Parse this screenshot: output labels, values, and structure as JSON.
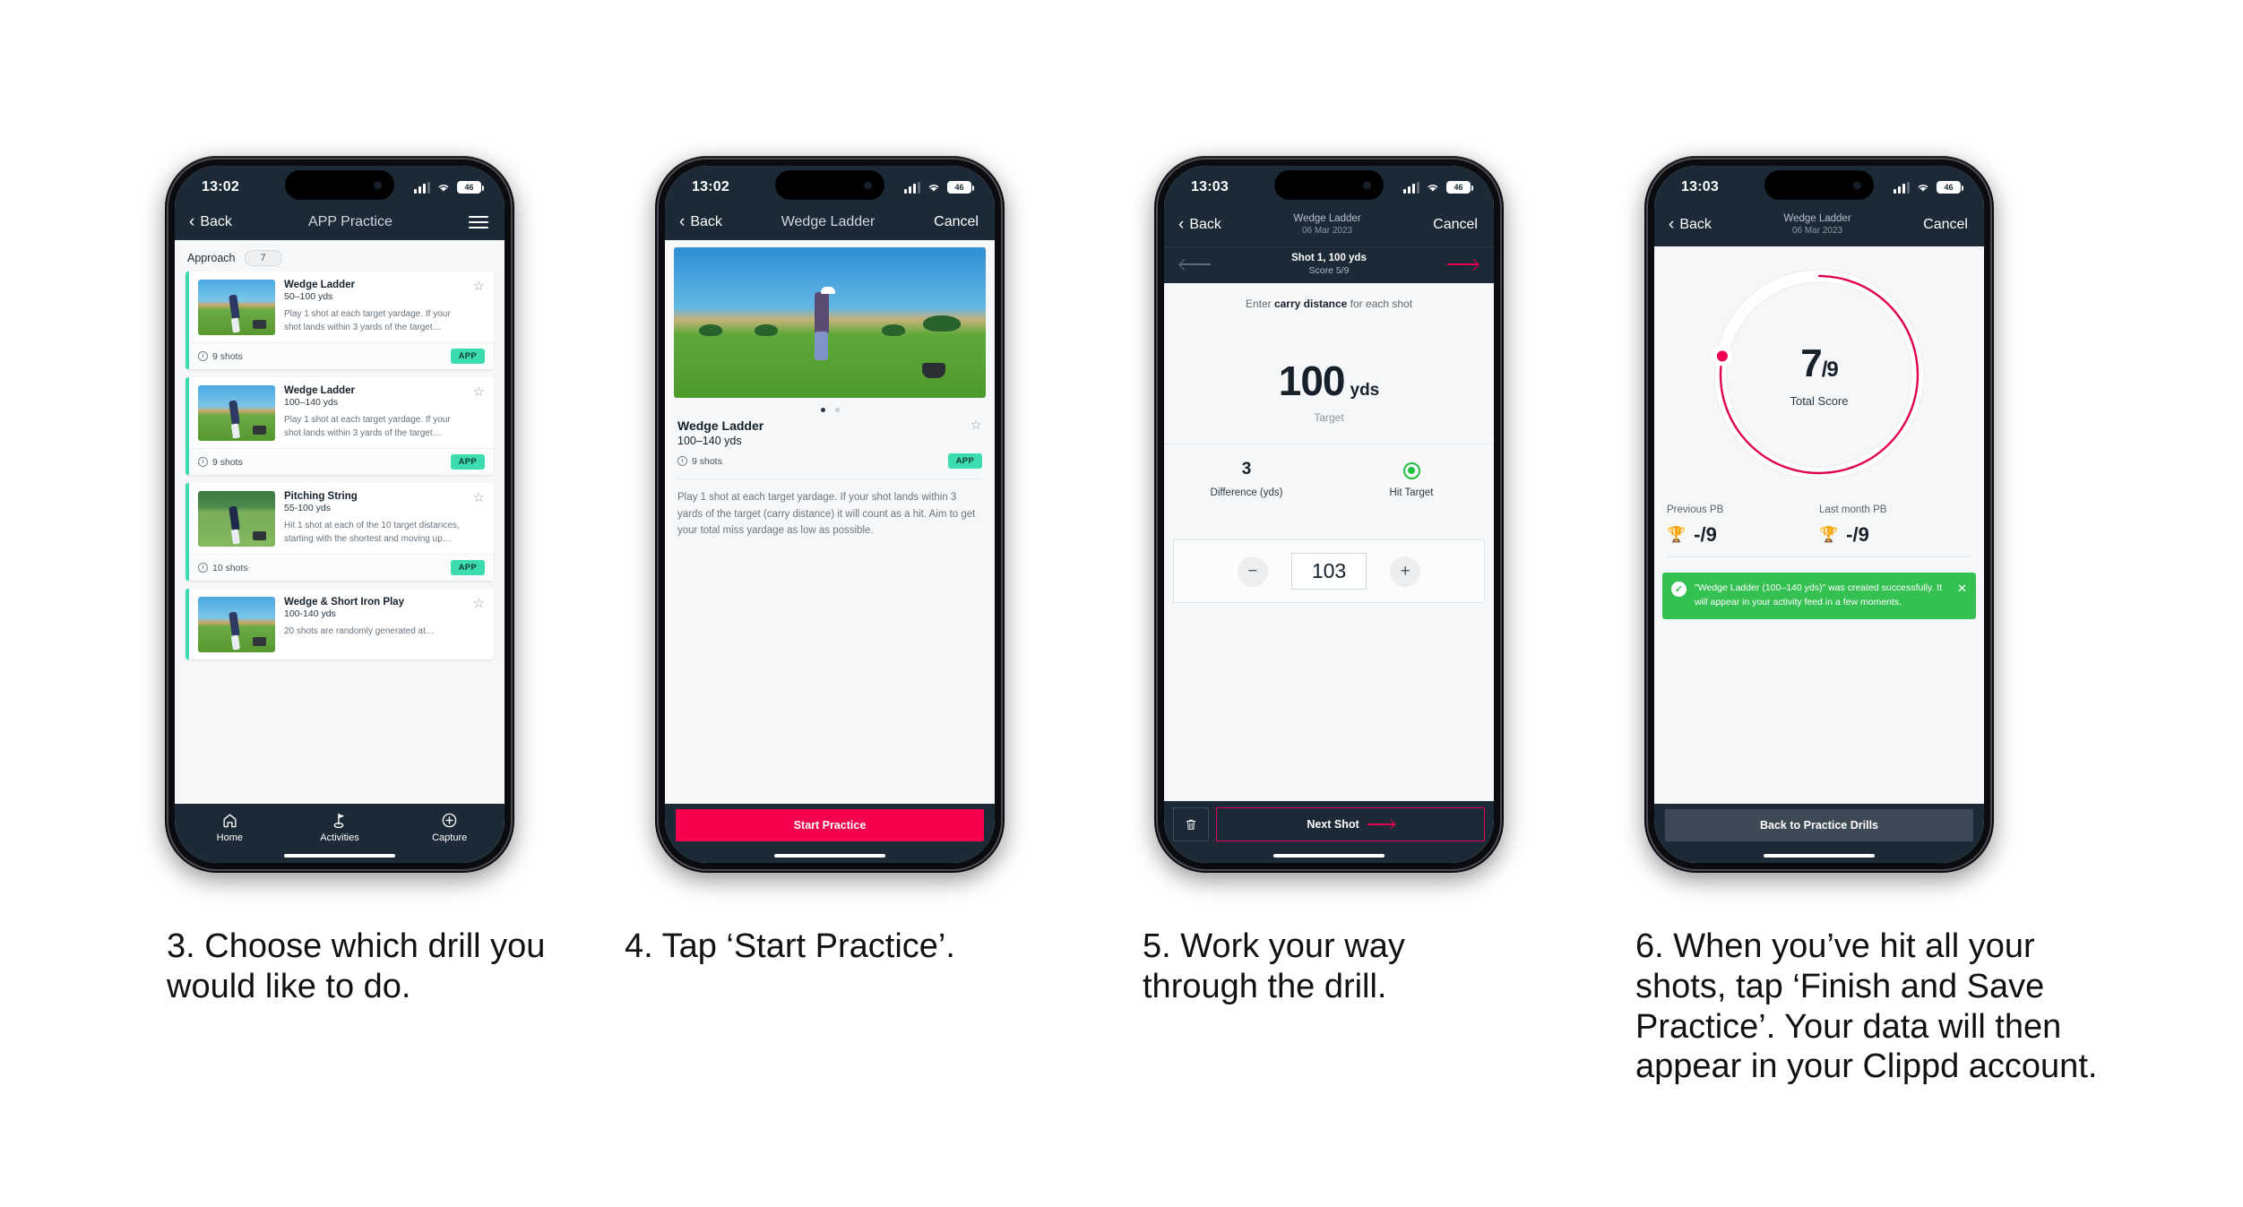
{
  "phones": [
    {
      "id": "phone-drill-list",
      "status": {
        "time": "13:02",
        "battery": "46"
      },
      "nav": {
        "back": "Back",
        "title": "APP Practice"
      },
      "filter": {
        "label": "Approach",
        "count": "7"
      },
      "cards": [
        {
          "title": "Wedge Ladder",
          "sub": "50–100 yds",
          "desc": "Play 1 shot at each target yardage. If your shot lands within 3 yards of the target…",
          "shots": "9 shots",
          "tag": "APP"
        },
        {
          "title": "Wedge Ladder",
          "sub": "100–140 yds",
          "desc": "Play 1 shot at each target yardage. If your shot lands within 3 yards of the target…",
          "shots": "9 shots",
          "tag": "APP"
        },
        {
          "title": "Pitching String",
          "sub": "55-100 yds",
          "desc": "Hit 1 shot at each of the 10 target distances, starting with the shortest and moving up…",
          "shots": "10 shots",
          "tag": "APP"
        },
        {
          "title": "Wedge & Short Iron Play",
          "sub": "100-140 yds",
          "desc": "20 shots are randomly generated at…",
          "shots": "",
          "tag": ""
        }
      ],
      "tabs": [
        {
          "label": "Home",
          "icon": "home-icon"
        },
        {
          "label": "Activities",
          "icon": "golf-flag-icon"
        },
        {
          "label": "Capture",
          "icon": "plus-circle-icon"
        }
      ]
    },
    {
      "id": "phone-drill-detail",
      "status": {
        "time": "13:02",
        "battery": "46"
      },
      "nav": {
        "back": "Back",
        "title": "Wedge Ladder",
        "cancel": "Cancel"
      },
      "detail": {
        "title": "Wedge Ladder",
        "sub": "100–140 yds",
        "shots": "9 shots",
        "tag": "APP",
        "description": "Play 1 shot at each target yardage. If your shot lands within 3 yards of the target (carry distance) it will count as a hit. Aim to get your total miss yardage as low as possible."
      },
      "cta": "Start Practice"
    },
    {
      "id": "phone-shot-entry",
      "status": {
        "time": "13:03",
        "battery": "46"
      },
      "nav": {
        "back": "Back",
        "title": "Wedge Ladder",
        "subtitle": "06 Mar 2023",
        "cancel": "Cancel"
      },
      "subnav": {
        "shot": "Shot 1, 100 yds",
        "score": "Score 5/9"
      },
      "hint_pre": "Enter ",
      "hint_bold": "carry distance",
      "hint_post": " for each shot",
      "target": {
        "value": "100",
        "unit": "yds",
        "caption": "Target"
      },
      "stats": [
        {
          "value": "3",
          "label": "Difference (yds)"
        },
        {
          "value": "",
          "label": "Hit Target"
        }
      ],
      "stepper": {
        "minus": "−",
        "value": "103",
        "plus": "+"
      },
      "footer": {
        "delete_icon": "trash-icon",
        "next": "Next Shot"
      }
    },
    {
      "id": "phone-summary",
      "status": {
        "time": "13:03",
        "battery": "46"
      },
      "nav": {
        "back": "Back",
        "title": "Wedge Ladder",
        "subtitle": "06 Mar 2023",
        "cancel": "Cancel"
      },
      "ring": {
        "score": "7",
        "slash": "/",
        "denominator": "9",
        "label": "Total Score",
        "percent": 78
      },
      "pbs": [
        {
          "label": "Previous PB",
          "value": "-/9"
        },
        {
          "label": "Last month PB",
          "value": "-/9"
        }
      ],
      "toast": {
        "message": "\"Wedge Ladder (100–140 yds)\" was created successfully. It will appear in your activity feed in a few moments."
      },
      "cta": "Back to Practice Drills"
    }
  ],
  "captions": [
    "3. Choose which drill you would like to do.",
    "4. Tap ‘Start Practice’.",
    "5. Work your way through the drill.",
    "6. When you’ve hit all your shots, tap ‘Finish and Save Practice’. Your data will then appear in your Clippd account."
  ],
  "colors": {
    "nav_dark": "#1b2a36",
    "accent_pink": "#f4004e",
    "accent_teal": "#3ddbb0",
    "toast_green": "#35c152"
  }
}
